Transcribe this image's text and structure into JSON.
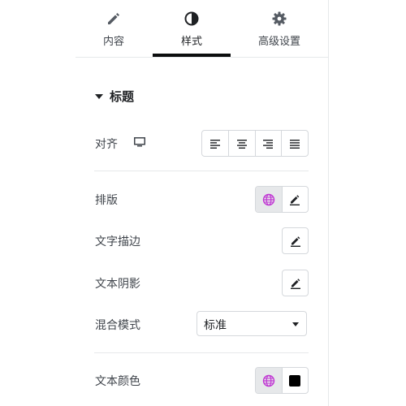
{
  "tabs": {
    "content": "内容",
    "style": "样式",
    "advanced": "高级设置"
  },
  "section": {
    "title": "标题"
  },
  "rows": {
    "align": "对齐",
    "typography": "排版",
    "text_stroke": "文字描边",
    "text_shadow": "文本阴影",
    "blend_mode": "混合模式",
    "text_color": "文本颜色"
  },
  "blend_select": {
    "value": "标准"
  },
  "text_color": {
    "swatch": "#000000"
  },
  "colors": {
    "globe": "#c036d3",
    "active_tab": "#0c0d0e",
    "border": "#d5d8dc"
  },
  "icons": [
    "pencil-icon",
    "contrast-icon",
    "gear-icon",
    "desktop-icon",
    "align-left-icon",
    "align-center-icon",
    "align-right-icon",
    "align-justify-icon",
    "globe-icon",
    "edit-icon"
  ]
}
